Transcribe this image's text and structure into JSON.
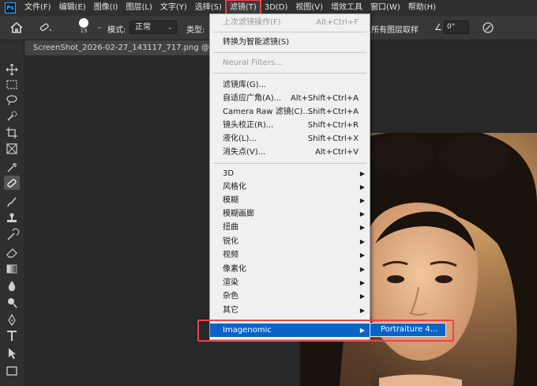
{
  "app": {
    "logo_text": "Ps"
  },
  "menubar": {
    "items": [
      {
        "label": "文件(F)"
      },
      {
        "label": "编辑(E)"
      },
      {
        "label": "图像(I)"
      },
      {
        "label": "图层(L)"
      },
      {
        "label": "文字(Y)"
      },
      {
        "label": "选择(S)"
      },
      {
        "label": "滤镜(T)"
      },
      {
        "label": "3D(D)"
      },
      {
        "label": "视图(V)"
      },
      {
        "label": "增效工具"
      },
      {
        "label": "窗口(W)"
      },
      {
        "label": "帮助(H)"
      }
    ]
  },
  "options": {
    "brush_size": "19",
    "mode_label": "模式:",
    "mode_value": "正常",
    "type_label": "类型:",
    "sample_all": "所有图层取样",
    "angle_value": "0°"
  },
  "document": {
    "tab_title": "ScreenShot_2026-02-27_143117_717.png @ 100% ("
  },
  "filter_menu": {
    "last_filter": {
      "label": "上次滤镜操作(F)",
      "shortcut": "Alt+Ctrl+F"
    },
    "smart": {
      "label": "转换为智能滤镜(S)"
    },
    "neural": {
      "label": "Neural Filters..."
    },
    "gallery": {
      "label": "滤镜库(G)..."
    },
    "adaptive": {
      "label": "自适应广角(A)...",
      "shortcut": "Alt+Shift+Ctrl+A"
    },
    "camera_raw": {
      "label": "Camera Raw 滤镜(C)...",
      "shortcut": "Shift+Ctrl+A"
    },
    "lens": {
      "label": "镜头校正(R)...",
      "shortcut": "Shift+Ctrl+R"
    },
    "liquify": {
      "label": "液化(L)...",
      "shortcut": "Shift+Ctrl+X"
    },
    "vanishing": {
      "label": "消失点(V)...",
      "shortcut": "Alt+Ctrl+V"
    },
    "sub_3d": {
      "label": "3D"
    },
    "stylize": {
      "label": "风格化"
    },
    "blur": {
      "label": "模糊"
    },
    "blur_gallery": {
      "label": "模糊画廊"
    },
    "distort": {
      "label": "扭曲"
    },
    "sharpen": {
      "label": "锐化"
    },
    "video": {
      "label": "视频"
    },
    "pixelate": {
      "label": "像素化"
    },
    "render": {
      "label": "渲染"
    },
    "noise": {
      "label": "杂色"
    },
    "other": {
      "label": "其它"
    },
    "imagenomic": {
      "label": "Imagenomic"
    }
  },
  "submenu": {
    "item": "Portraiture 4..."
  },
  "colors": {
    "menu_highlight": "#0a64c8",
    "annotation_red": "#e8454a"
  }
}
